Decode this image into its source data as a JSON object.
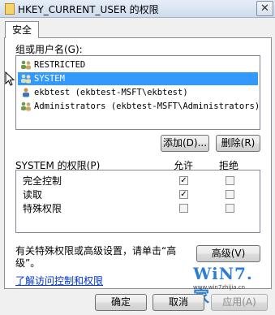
{
  "window": {
    "title": "HKEY_CURRENT_USER 的权限",
    "close_glyph": "✕"
  },
  "tabs": [
    {
      "label": "安全"
    }
  ],
  "users_section": {
    "label": "组或用户名(G):",
    "items": [
      {
        "name": "RESTRICTED",
        "selected": false
      },
      {
        "name": "SYSTEM",
        "selected": true
      },
      {
        "name": "ekbtest (ekbtest-MSFT\\ekbtest)",
        "selected": false
      },
      {
        "name": "Administrators (ekbtest-MSFT\\Administrators)",
        "selected": false
      }
    ],
    "add_button": "添加(D)...",
    "remove_button": "删除(R)"
  },
  "permissions": {
    "header_label": "SYSTEM 的权限(P)",
    "allow_label": "允许",
    "deny_label": "拒绝",
    "rows": [
      {
        "name": "完全控制",
        "allow": true,
        "deny": false
      },
      {
        "name": "读取",
        "allow": true,
        "deny": false
      },
      {
        "name": "特殊权限",
        "allow": false,
        "deny": false
      }
    ]
  },
  "advanced": {
    "text_line1": "有关特殊权限或高级设置，请单击“高",
    "text_line2": "级”。",
    "button": "高级(V)"
  },
  "link": {
    "label": "了解访问控制和权限"
  },
  "watermark": {
    "brand": "WiN7.家",
    "url": "www.win7zhijia.cn"
  },
  "footer": {
    "ok": "确定",
    "cancel": "取消",
    "apply": "应用(A)"
  },
  "colors": {
    "selection": "#3399ff",
    "link": "#0033cc"
  }
}
